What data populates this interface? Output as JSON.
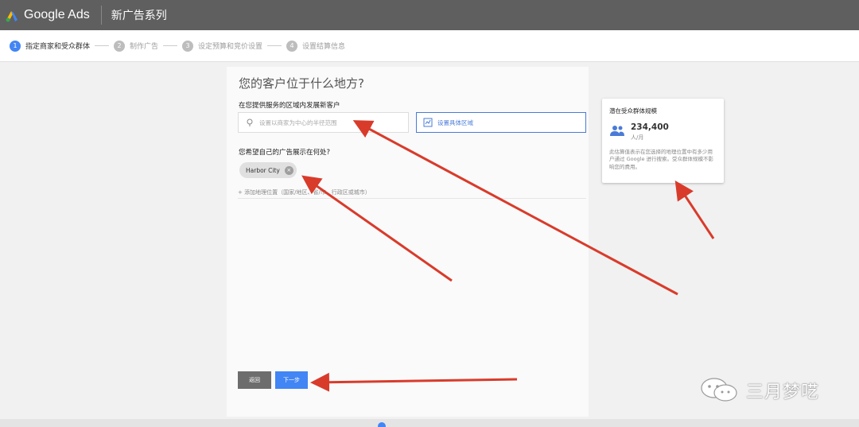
{
  "app": {
    "brand": "Google Ads",
    "campaign_title": "新广告系列"
  },
  "steps": [
    {
      "num": "1",
      "label": "指定商家和受众群体"
    },
    {
      "num": "2",
      "label": "制作广告"
    },
    {
      "num": "3",
      "label": "设定预算和竞价设置"
    },
    {
      "num": "4",
      "label": "设置结算信息"
    }
  ],
  "main": {
    "question": "您的客户位于什么地方?",
    "section1_label": "在您提供服务的区域内发展新客户",
    "radius_option": "设置以商家为中心的半径范围",
    "area_option": "设置具体区域",
    "section2_label": "您希望自己的广告展示在何处?",
    "location_chip": "Harbor City",
    "add_location": "+ 添加地理位置（国家/地区、省/市、行政区或城市）",
    "back_button": "返回",
    "next_button": "下一步"
  },
  "audience_card": {
    "title": "潜在受众群体规模",
    "count": "234,400",
    "unit": "人/月",
    "description": "此估算值表示在您选择的地理位置中有多少用户通过 Google 进行搜索。受众群体规模不影响您的费用。"
  },
  "watermark": {
    "text": "三月梦呓",
    "icon": "wechat-icon"
  },
  "colors": {
    "accent": "#4285f4",
    "topbar": "#5f5f5f",
    "arrow": "#d93b2b"
  }
}
